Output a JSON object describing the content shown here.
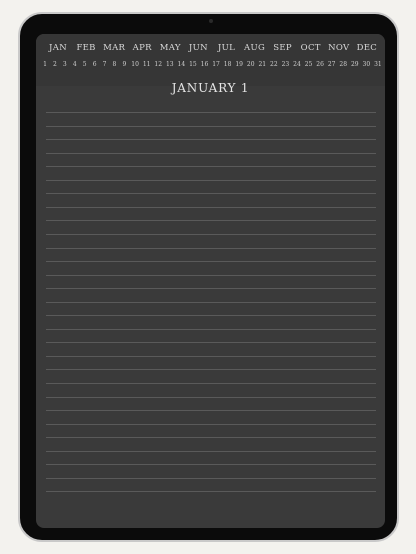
{
  "months": [
    "JAN",
    "FEB",
    "MAR",
    "APR",
    "MAY",
    "JUN",
    "JUL",
    "AUG",
    "SEP",
    "OCT",
    "NOV",
    "DEC"
  ],
  "days": [
    "1",
    "2",
    "3",
    "4",
    "5",
    "6",
    "7",
    "8",
    "9",
    "10",
    "11",
    "12",
    "13",
    "14",
    "15",
    "16",
    "17",
    "18",
    "19",
    "20",
    "21",
    "22",
    "23",
    "24",
    "25",
    "26",
    "27",
    "28",
    "29",
    "30",
    "31"
  ],
  "page": {
    "title": "JANUARY 1"
  },
  "colors": {
    "screen": "#3a3a3a",
    "frame": "#0b0b0b",
    "background": "#f3f2ee",
    "rule": "#5a5a5a"
  }
}
